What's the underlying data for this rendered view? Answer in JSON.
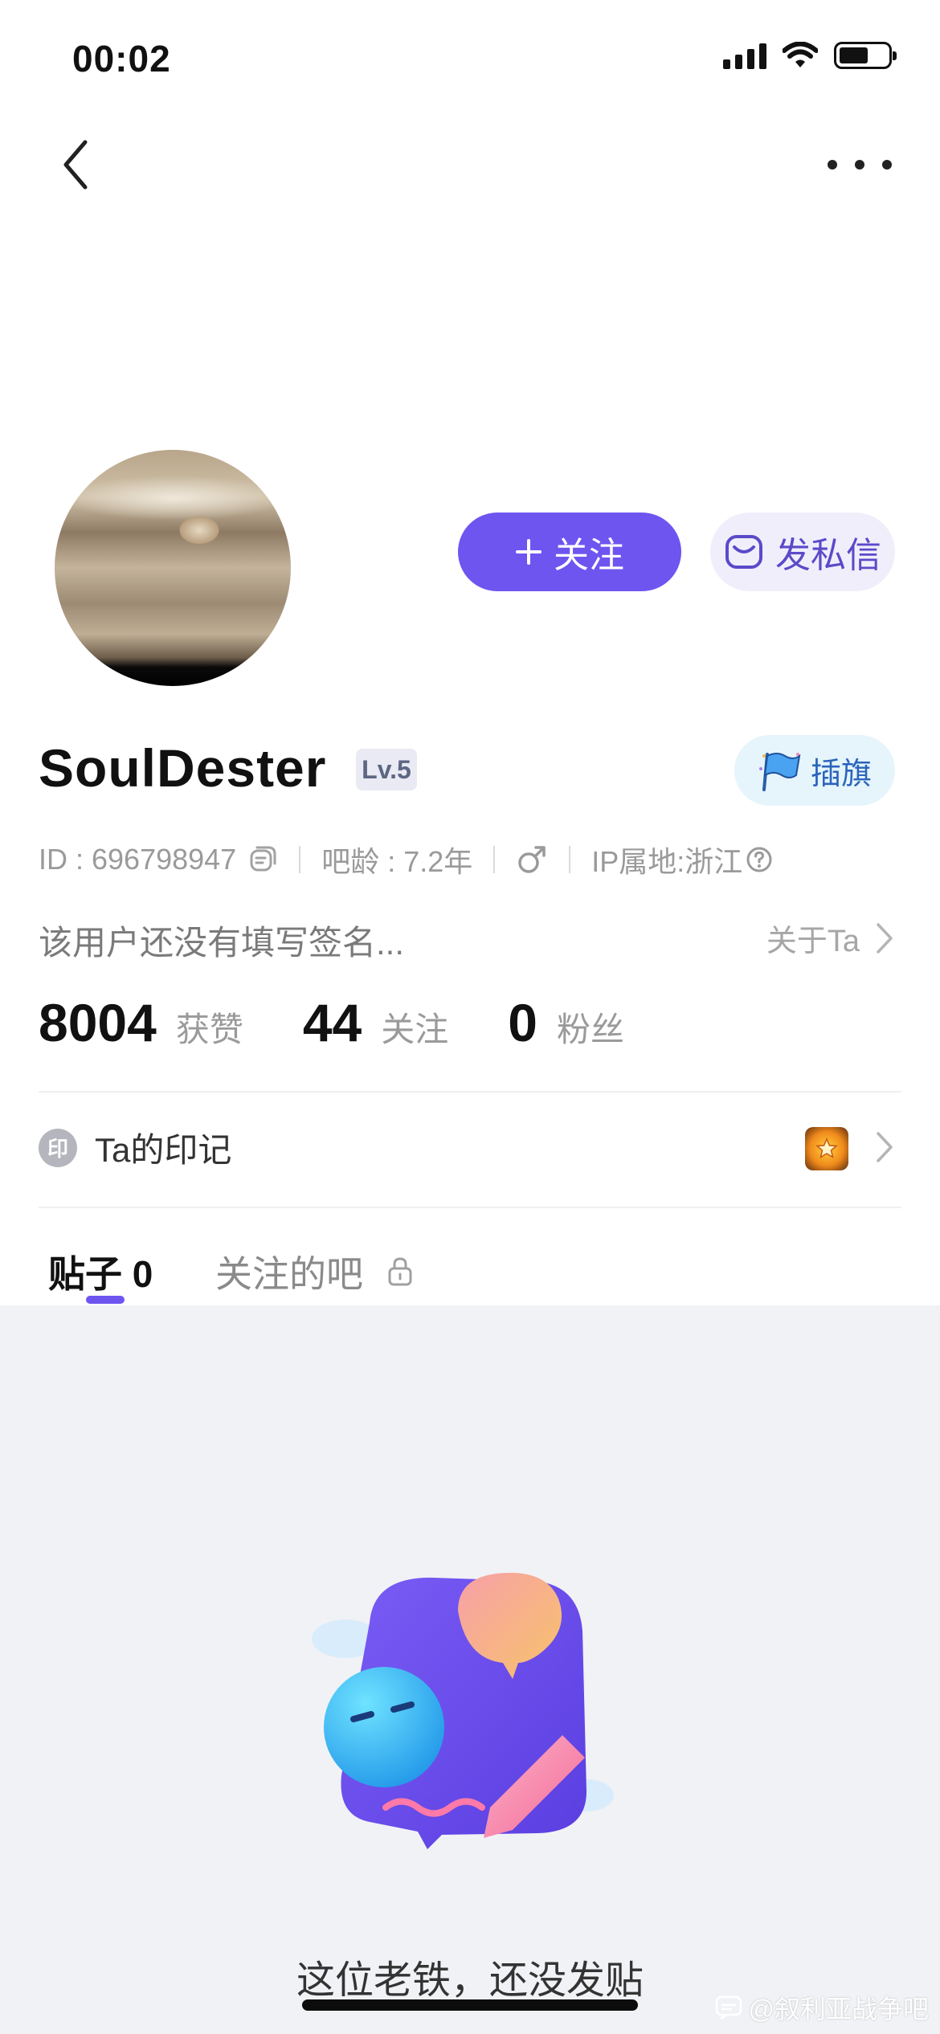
{
  "status_bar": {
    "time": "00:02"
  },
  "profile": {
    "username": "SoulDester",
    "level": "Lv.5",
    "follow_label": "关注",
    "message_label": "发私信",
    "flag_label": "插旗",
    "id_text": "ID : 696798947",
    "bar_age": "吧龄 : 7.2年",
    "ip_location": "IP属地:浙江",
    "signature": "该用户还没有填写签名...",
    "about_label": "关于Ta"
  },
  "stats": [
    {
      "value": "8004",
      "label": "获赞"
    },
    {
      "value": "44",
      "label": "关注"
    },
    {
      "value": "0",
      "label": "粉丝"
    }
  ],
  "imprint": {
    "seal": "印",
    "label": "Ta的印记"
  },
  "tabs": [
    {
      "label": "贴子 0",
      "active": true
    },
    {
      "label": "关注的吧",
      "locked": true
    }
  ],
  "empty_state": {
    "message": "这位老铁，还没发贴"
  },
  "watermark": "@叙利亚战争吧",
  "colors": {
    "accent": "#6e55f0",
    "content_bg": "#f1f2f5"
  }
}
